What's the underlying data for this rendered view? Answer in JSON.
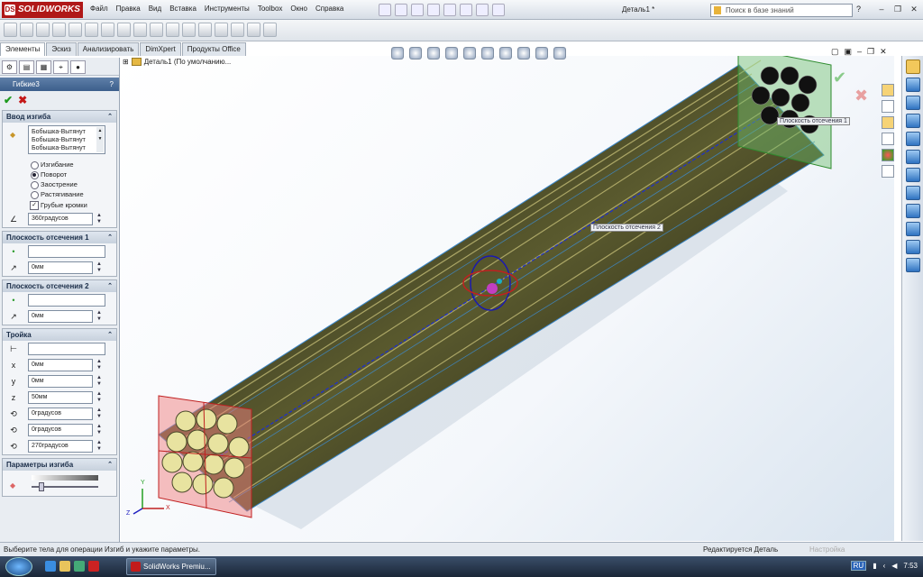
{
  "app": {
    "logo": "SOLIDWORKS",
    "doc_title": "Деталь1 *",
    "help": "?"
  },
  "menu": [
    "Файл",
    "Правка",
    "Вид",
    "Вставка",
    "Инструменты",
    "Toolbox",
    "Окно",
    "Справка"
  ],
  "search": {
    "placeholder": "Поиск в базе знаний"
  },
  "tabs": [
    "Элементы",
    "Эскиз",
    "Анализировать",
    "DimXpert",
    "Продукты Office"
  ],
  "panel": {
    "feature_name": "Гибкие3",
    "help": "?",
    "sections": {
      "bend_input": {
        "title": "Ввод изгиба",
        "bodies": [
          "Бобышка-Вытянут",
          "Бобышка-Вытянут",
          "Бобышка-Вытянут"
        ],
        "options": [
          "Изгибание",
          "Поворот",
          "Заострение",
          "Растягивание"
        ],
        "selected_option": "Поворот",
        "rough_edges": "Грубые кромки",
        "angle": "360градусов"
      },
      "trim_plane1": {
        "title": "Плоскость отсечения 1",
        "ref": "",
        "offset": "0мм"
      },
      "trim_plane2": {
        "title": "Плоскость отсечения 2",
        "ref": "",
        "offset": "0мм"
      },
      "triad": {
        "title": "Тройка",
        "ref": "",
        "x": "0мм",
        "y": "0мм",
        "z": "50мм",
        "rx": "0градусов",
        "ry": "0градусов",
        "rz": "270градусов"
      },
      "bend_params": {
        "title": "Параметры изгиба"
      }
    }
  },
  "viewport": {
    "tree_label": "Деталь1  (По умолчанию...",
    "plane1_label": "Плоскость отсечения 1",
    "plane2_label": "Плоскость отсечения 2",
    "axes": {
      "x": "X",
      "y": "Y",
      "z": "Z"
    }
  },
  "status": {
    "message": "Выберите тела для операции Изгиб и укажите параметры.",
    "editing": "Редактируется Деталь",
    "settings": "Настройка"
  },
  "taskbar": {
    "app_button": "SolidWorks Premiu...",
    "lang": "RU",
    "time": "7:53"
  }
}
